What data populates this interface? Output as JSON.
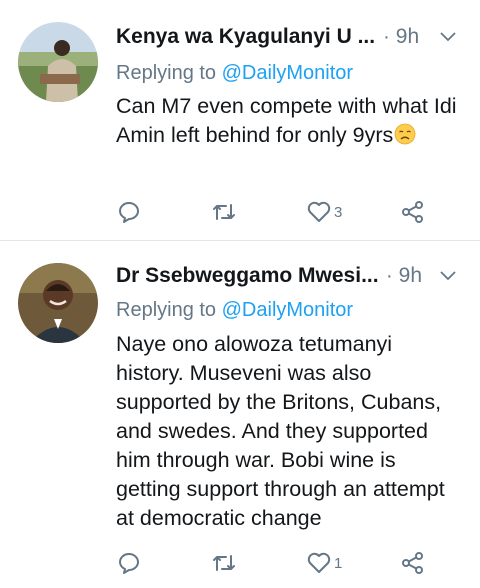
{
  "tweets": [
    {
      "name": "Kenya wa Kyagulanyi",
      "name_suffix": "U ...",
      "time": "9h",
      "reply_prefix": "Replying to",
      "reply_handle": "@DailyMonitor",
      "text": "Can M7 even compete with what Idi Amin left behind for only 9yrs",
      "emoji": "disappointed-face",
      "likes": "3"
    },
    {
      "name": "Dr Ssebweggamo Mwesi...",
      "time": "9h",
      "reply_prefix": "Replying to",
      "reply_handle": "@DailyMonitor",
      "text": "Naye ono alowoza tetumanyi history. Museveni was also supported by the Britons, Cubans, and swedes. And they supported him through war. Bobi wine is getting support through an attempt at democratic change",
      "likes": "1"
    }
  ],
  "icons": {
    "reply": "reply-icon",
    "retweet": "retweet-icon",
    "like": "heart-icon",
    "share": "share-icon",
    "menu": "chevron-down-icon"
  },
  "colors": {
    "link": "#1da1f2",
    "secondary_text": "#657786",
    "primary_text": "#14171a",
    "icon": "#657786",
    "divider": "#e1e8ed"
  }
}
